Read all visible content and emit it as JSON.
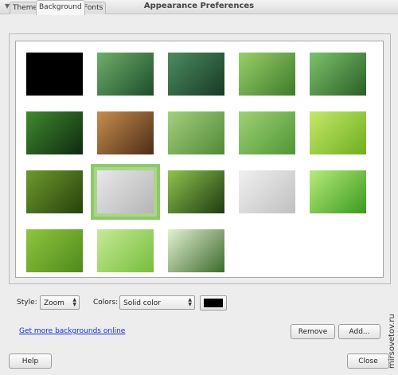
{
  "window": {
    "title": "Appearance Preferences"
  },
  "tabs": [
    {
      "label": "Theme",
      "active": false
    },
    {
      "label": "Background",
      "active": true
    },
    {
      "label": "Fonts",
      "active": false
    }
  ],
  "wallpapers": [
    {
      "name": "black",
      "colors": [
        "#000000",
        "#000000"
      ],
      "selected": false
    },
    {
      "name": "leaf-water-drops",
      "colors": [
        "#6fae6a",
        "#1d4d2a"
      ],
      "selected": false
    },
    {
      "name": "water-drops-dark-leaf",
      "colors": [
        "#4d8c61",
        "#173a25"
      ],
      "selected": false
    },
    {
      "name": "branch-drop",
      "colors": [
        "#9ad06a",
        "#3e7a2a"
      ],
      "selected": false
    },
    {
      "name": "grass-blades",
      "colors": [
        "#7cc36b",
        "#2a5e26"
      ],
      "selected": false
    },
    {
      "name": "fern",
      "colors": [
        "#3f8a2e",
        "#0f2a10"
      ],
      "selected": false
    },
    {
      "name": "pebbles",
      "colors": [
        "#c88d4d",
        "#4c2d17"
      ],
      "selected": false
    },
    {
      "name": "green-curves",
      "colors": [
        "#a6cf7c",
        "#4f8a38"
      ],
      "selected": false
    },
    {
      "name": "green-bubbles",
      "colors": [
        "#9fd175",
        "#4f9636"
      ],
      "selected": false
    },
    {
      "name": "lime-gradient",
      "colors": [
        "#c5e86a",
        "#6fae1f"
      ],
      "selected": false
    },
    {
      "name": "dark-green-blur",
      "colors": [
        "#6d9a2c",
        "#27420c"
      ],
      "selected": false
    },
    {
      "name": "mint-logo-1",
      "colors": [
        "#e8e8e8",
        "#b5b5b5"
      ],
      "selected": true
    },
    {
      "name": "green-glow",
      "colors": [
        "#8fc44e",
        "#1e3a10"
      ],
      "selected": false
    },
    {
      "name": "mint-logo-2",
      "colors": [
        "#f0f0f0",
        "#c0c0c0"
      ],
      "selected": false
    },
    {
      "name": "grass",
      "colors": [
        "#b8eb7c",
        "#3a9a1d"
      ],
      "selected": false
    },
    {
      "name": "green-mosaic",
      "colors": [
        "#8ec63d",
        "#4f8a1c"
      ],
      "selected": false
    },
    {
      "name": "bokeh",
      "colors": [
        "#c6ea96",
        "#76bd3d"
      ],
      "selected": false
    },
    {
      "name": "green-stripes",
      "colors": [
        "#e3f1d1",
        "#3c6a2c"
      ],
      "selected": false
    }
  ],
  "controls": {
    "style_label": "Style:",
    "style_value": "Zoom",
    "colors_label": "Colors:",
    "colors_value": "Solid color",
    "color_swatch": "#000000"
  },
  "links": {
    "more_backgrounds": "Get more backgrounds online"
  },
  "buttons": {
    "remove": "Remove",
    "add": "Add...",
    "help": "Help",
    "close": "Close"
  },
  "watermark": "mirsovetov.ru"
}
